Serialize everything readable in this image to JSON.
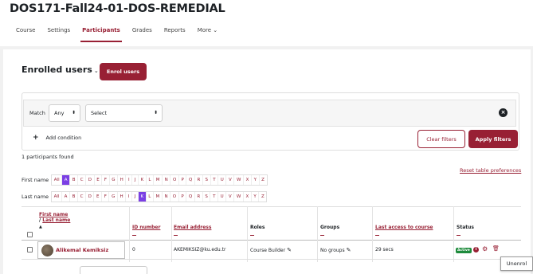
{
  "course": {
    "title": "DOS171-Fall24-01-DOS-REMEDIAL"
  },
  "nav": {
    "items": [
      {
        "label": "Course"
      },
      {
        "label": "Settings"
      },
      {
        "label": "Participants",
        "active": true
      },
      {
        "label": "Grades"
      },
      {
        "label": "Reports"
      },
      {
        "label": "More"
      }
    ],
    "more_chevron": "⌄"
  },
  "enrolled": {
    "title": "Enrolled users",
    "title_chevron": "⌄",
    "enrol_button": "Enrol users"
  },
  "filters": {
    "match_label": "Match",
    "match_value": "Any",
    "select_placeholder": "Select",
    "add_condition": "Add condition",
    "clear_button": "Clear filters",
    "apply_button": "Apply filters"
  },
  "participants_found": "1 participants found",
  "reset_link": "Reset table preferences",
  "first_name_bar": {
    "label": "First name",
    "letters": [
      "All",
      "A",
      "B",
      "C",
      "D",
      "E",
      "F",
      "G",
      "H",
      "I",
      "J",
      "K",
      "L",
      "M",
      "N",
      "O",
      "P",
      "Q",
      "R",
      "S",
      "T",
      "U",
      "V",
      "W",
      "X",
      "Y",
      "Z"
    ],
    "selected": "A"
  },
  "last_name_bar": {
    "label": "Last name",
    "letters": [
      "All",
      "A",
      "B",
      "C",
      "D",
      "E",
      "F",
      "G",
      "H",
      "I",
      "J",
      "K",
      "L",
      "M",
      "N",
      "O",
      "P",
      "Q",
      "R",
      "S",
      "T",
      "U",
      "V",
      "W",
      "X",
      "Y",
      "Z"
    ],
    "selected": "K"
  },
  "table": {
    "headers": {
      "first_name": "First name",
      "last_name": "Last name",
      "sort_indicator": "▲",
      "id_number": "ID number",
      "email": "Email address",
      "roles": "Roles",
      "groups": "Groups",
      "last_access": "Last access to course",
      "status": "Status"
    },
    "rows": [
      {
        "name": "Alikemal Kemiksiz",
        "id_number": "0",
        "email": "AKEMIKSIZ@ku.edu.tr",
        "role": "Course Builder",
        "groups": "No groups",
        "last_access": "29 secs",
        "status": "Active"
      }
    ]
  },
  "tooltip": "Unenrol",
  "colors": {
    "accent": "#982034",
    "selected_letter": "#7b3fe4",
    "active_badge": "#1e8b3c"
  }
}
